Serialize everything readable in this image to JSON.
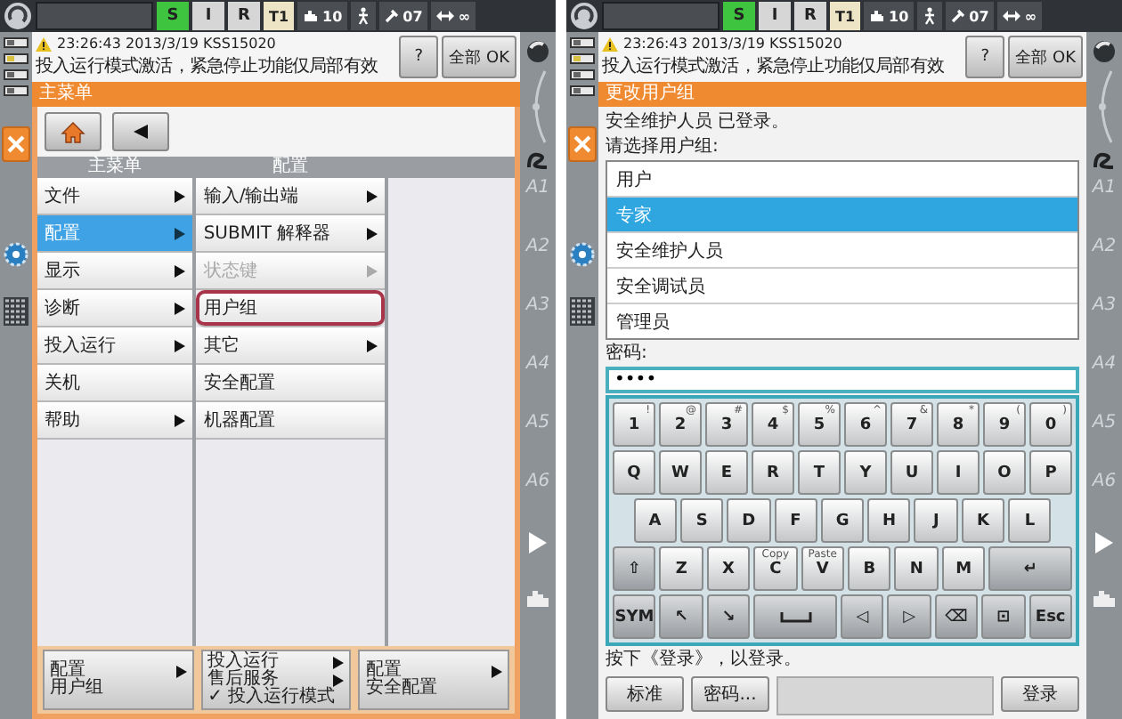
{
  "screens": [
    {
      "kind": "main_menu",
      "status_bar": {
        "mode_keys": [
          {
            "label": "S",
            "selected": true
          },
          {
            "label": "I",
            "selected": false
          },
          {
            "label": "R",
            "selected": false
          }
        ],
        "readouts": [
          {
            "kind": "op_mode",
            "label": "T1"
          },
          {
            "kind": "speed",
            "label": "10"
          },
          {
            "kind": "tool",
            "label": "07"
          },
          {
            "kind": "jog",
            "label": "∞"
          }
        ]
      },
      "message": {
        "time": "23:26:43 2013/3/19 KSS15020",
        "text": "投入运行模式激活，紧急停止功能仅局部有效",
        "buttons": [
          "?",
          "全部 OK"
        ]
      },
      "axis_labels": [
        "A1",
        "A2",
        "A3",
        "A4",
        "A5",
        "A6"
      ],
      "title": "主菜单",
      "columns": [
        {
          "heading": "主菜单",
          "items": [
            {
              "label": "文件",
              "submenu": true,
              "selected": false,
              "disabled": false,
              "outlined": false
            },
            {
              "label": "配置",
              "submenu": true,
              "selected": true,
              "disabled": false,
              "outlined": false
            },
            {
              "label": "显示",
              "submenu": true,
              "selected": false,
              "disabled": false,
              "outlined": false
            },
            {
              "label": "诊断",
              "submenu": true,
              "selected": false,
              "disabled": false,
              "outlined": false
            },
            {
              "label": "投入运行",
              "submenu": true,
              "selected": false,
              "disabled": false,
              "outlined": false
            },
            {
              "label": "关机",
              "submenu": false,
              "selected": false,
              "disabled": false,
              "outlined": false
            },
            {
              "label": "帮助",
              "submenu": true,
              "selected": false,
              "disabled": false,
              "outlined": false
            }
          ]
        },
        {
          "heading": "配置",
          "items": [
            {
              "label": "输入/输出端",
              "submenu": true,
              "selected": false,
              "disabled": false,
              "outlined": false
            },
            {
              "label": "SUBMIT 解释器",
              "submenu": true,
              "selected": false,
              "disabled": false,
              "outlined": false
            },
            {
              "label": "状态键",
              "submenu": true,
              "selected": false,
              "disabled": true,
              "outlined": false
            },
            {
              "label": "用户组",
              "submenu": false,
              "selected": false,
              "disabled": false,
              "outlined": true
            },
            {
              "label": "其它",
              "submenu": true,
              "selected": false,
              "disabled": false,
              "outlined": false
            },
            {
              "label": "安全配置",
              "submenu": false,
              "selected": false,
              "disabled": false,
              "outlined": false
            },
            {
              "label": "机器配置",
              "submenu": false,
              "selected": false,
              "disabled": false,
              "outlined": false
            }
          ]
        }
      ],
      "breadcrumbs": [
        {
          "lines": [
            {
              "text": "配置",
              "arrow": true
            },
            {
              "text": "用户组",
              "arrow": false
            }
          ]
        },
        {
          "lines": [
            {
              "text": "投入运行",
              "arrow": true
            },
            {
              "text": "售后服务",
              "arrow": true
            },
            {
              "text": "✓ 投入运行模式",
              "arrow": false
            }
          ]
        },
        {
          "lines": [
            {
              "text": "配置",
              "arrow": true
            },
            {
              "text": "安全配置",
              "arrow": false
            }
          ]
        }
      ]
    },
    {
      "kind": "login",
      "status_bar": {
        "mode_keys": [
          {
            "label": "S",
            "selected": true
          },
          {
            "label": "I",
            "selected": false
          },
          {
            "label": "R",
            "selected": false
          }
        ],
        "readouts": [
          {
            "kind": "op_mode",
            "label": "T1"
          },
          {
            "kind": "speed",
            "label": "10"
          },
          {
            "kind": "tool",
            "label": "07"
          },
          {
            "kind": "jog",
            "label": "∞"
          }
        ]
      },
      "message": {
        "time": "23:26:43 2013/3/19 KSS15020",
        "text": "投入运行模式激活，紧急停止功能仅局部有效",
        "buttons": [
          "?",
          "全部 OK"
        ]
      },
      "axis_labels": [
        "A1",
        "A2",
        "A3",
        "A4",
        "A5",
        "A6"
      ],
      "title": "更改用户组",
      "status_text": "安全维护人员 已登录。",
      "prompt": "请选择用户组:",
      "user_groups": [
        {
          "label": "用户",
          "selected": false
        },
        {
          "label": "专家",
          "selected": true
        },
        {
          "label": "安全维护人员",
          "selected": false
        },
        {
          "label": "安全调试员",
          "selected": false
        },
        {
          "label": "管理员",
          "selected": false
        }
      ],
      "password_label": "密码:",
      "password_value": "••••",
      "keyboard": [
        [
          {
            "kind": "key",
            "label": "1",
            "alt": "!"
          },
          {
            "kind": "key",
            "label": "2",
            "alt": "@"
          },
          {
            "kind": "key",
            "label": "3",
            "alt": "#"
          },
          {
            "kind": "key",
            "label": "4",
            "alt": "$"
          },
          {
            "kind": "key",
            "label": "5",
            "alt": "%"
          },
          {
            "kind": "key",
            "label": "6",
            "alt": "^"
          },
          {
            "kind": "key",
            "label": "7",
            "alt": "&"
          },
          {
            "kind": "key",
            "label": "8",
            "alt": "*"
          },
          {
            "kind": "key",
            "label": "9",
            "alt": "("
          },
          {
            "kind": "key",
            "label": "0",
            "alt": ")"
          }
        ],
        [
          {
            "kind": "key",
            "label": "Q"
          },
          {
            "kind": "key",
            "label": "W"
          },
          {
            "kind": "key",
            "label": "E"
          },
          {
            "kind": "key",
            "label": "R"
          },
          {
            "kind": "key",
            "label": "T"
          },
          {
            "kind": "key",
            "label": "Y"
          },
          {
            "kind": "key",
            "label": "U"
          },
          {
            "kind": "key",
            "label": "I"
          },
          {
            "kind": "key",
            "label": "O"
          },
          {
            "kind": "key",
            "label": "P"
          }
        ],
        [
          {
            "kind": "key",
            "label": "A"
          },
          {
            "kind": "key",
            "label": "S"
          },
          {
            "kind": "key",
            "label": "D"
          },
          {
            "kind": "key",
            "label": "F"
          },
          {
            "kind": "key",
            "label": "G"
          },
          {
            "kind": "key",
            "label": "H"
          },
          {
            "kind": "key",
            "label": "J"
          },
          {
            "kind": "key",
            "label": "K"
          },
          {
            "kind": "key",
            "label": "L"
          }
        ],
        [
          {
            "kind": "dark",
            "label": "⇧"
          },
          {
            "kind": "key",
            "label": "Z"
          },
          {
            "kind": "key",
            "label": "X"
          },
          {
            "kind": "key",
            "label": "C",
            "alt": "Copy"
          },
          {
            "kind": "key",
            "label": "V",
            "alt": "Paste"
          },
          {
            "kind": "key",
            "label": "B"
          },
          {
            "kind": "key",
            "label": "N"
          },
          {
            "kind": "key",
            "label": "M"
          },
          {
            "kind": "wide_dark",
            "label": "↵"
          }
        ],
        [
          {
            "kind": "dark",
            "label": "SYM"
          },
          {
            "kind": "dark",
            "label": "↖"
          },
          {
            "kind": "dark",
            "label": "↘"
          },
          {
            "kind": "space"
          },
          {
            "kind": "dark",
            "label": "◁"
          },
          {
            "kind": "dark",
            "label": "▷"
          },
          {
            "kind": "dark",
            "label": "⌫"
          },
          {
            "kind": "dark",
            "label": "⊡"
          },
          {
            "kind": "dark",
            "label": "Esc"
          }
        ]
      ],
      "hint": "按下《登录》，以登录。",
      "buttons": [
        {
          "kind": "button",
          "label": "标准"
        },
        {
          "kind": "button",
          "label": "密码..."
        },
        {
          "kind": "blank"
        },
        {
          "kind": "button",
          "label": "登录"
        }
      ]
    }
  ]
}
